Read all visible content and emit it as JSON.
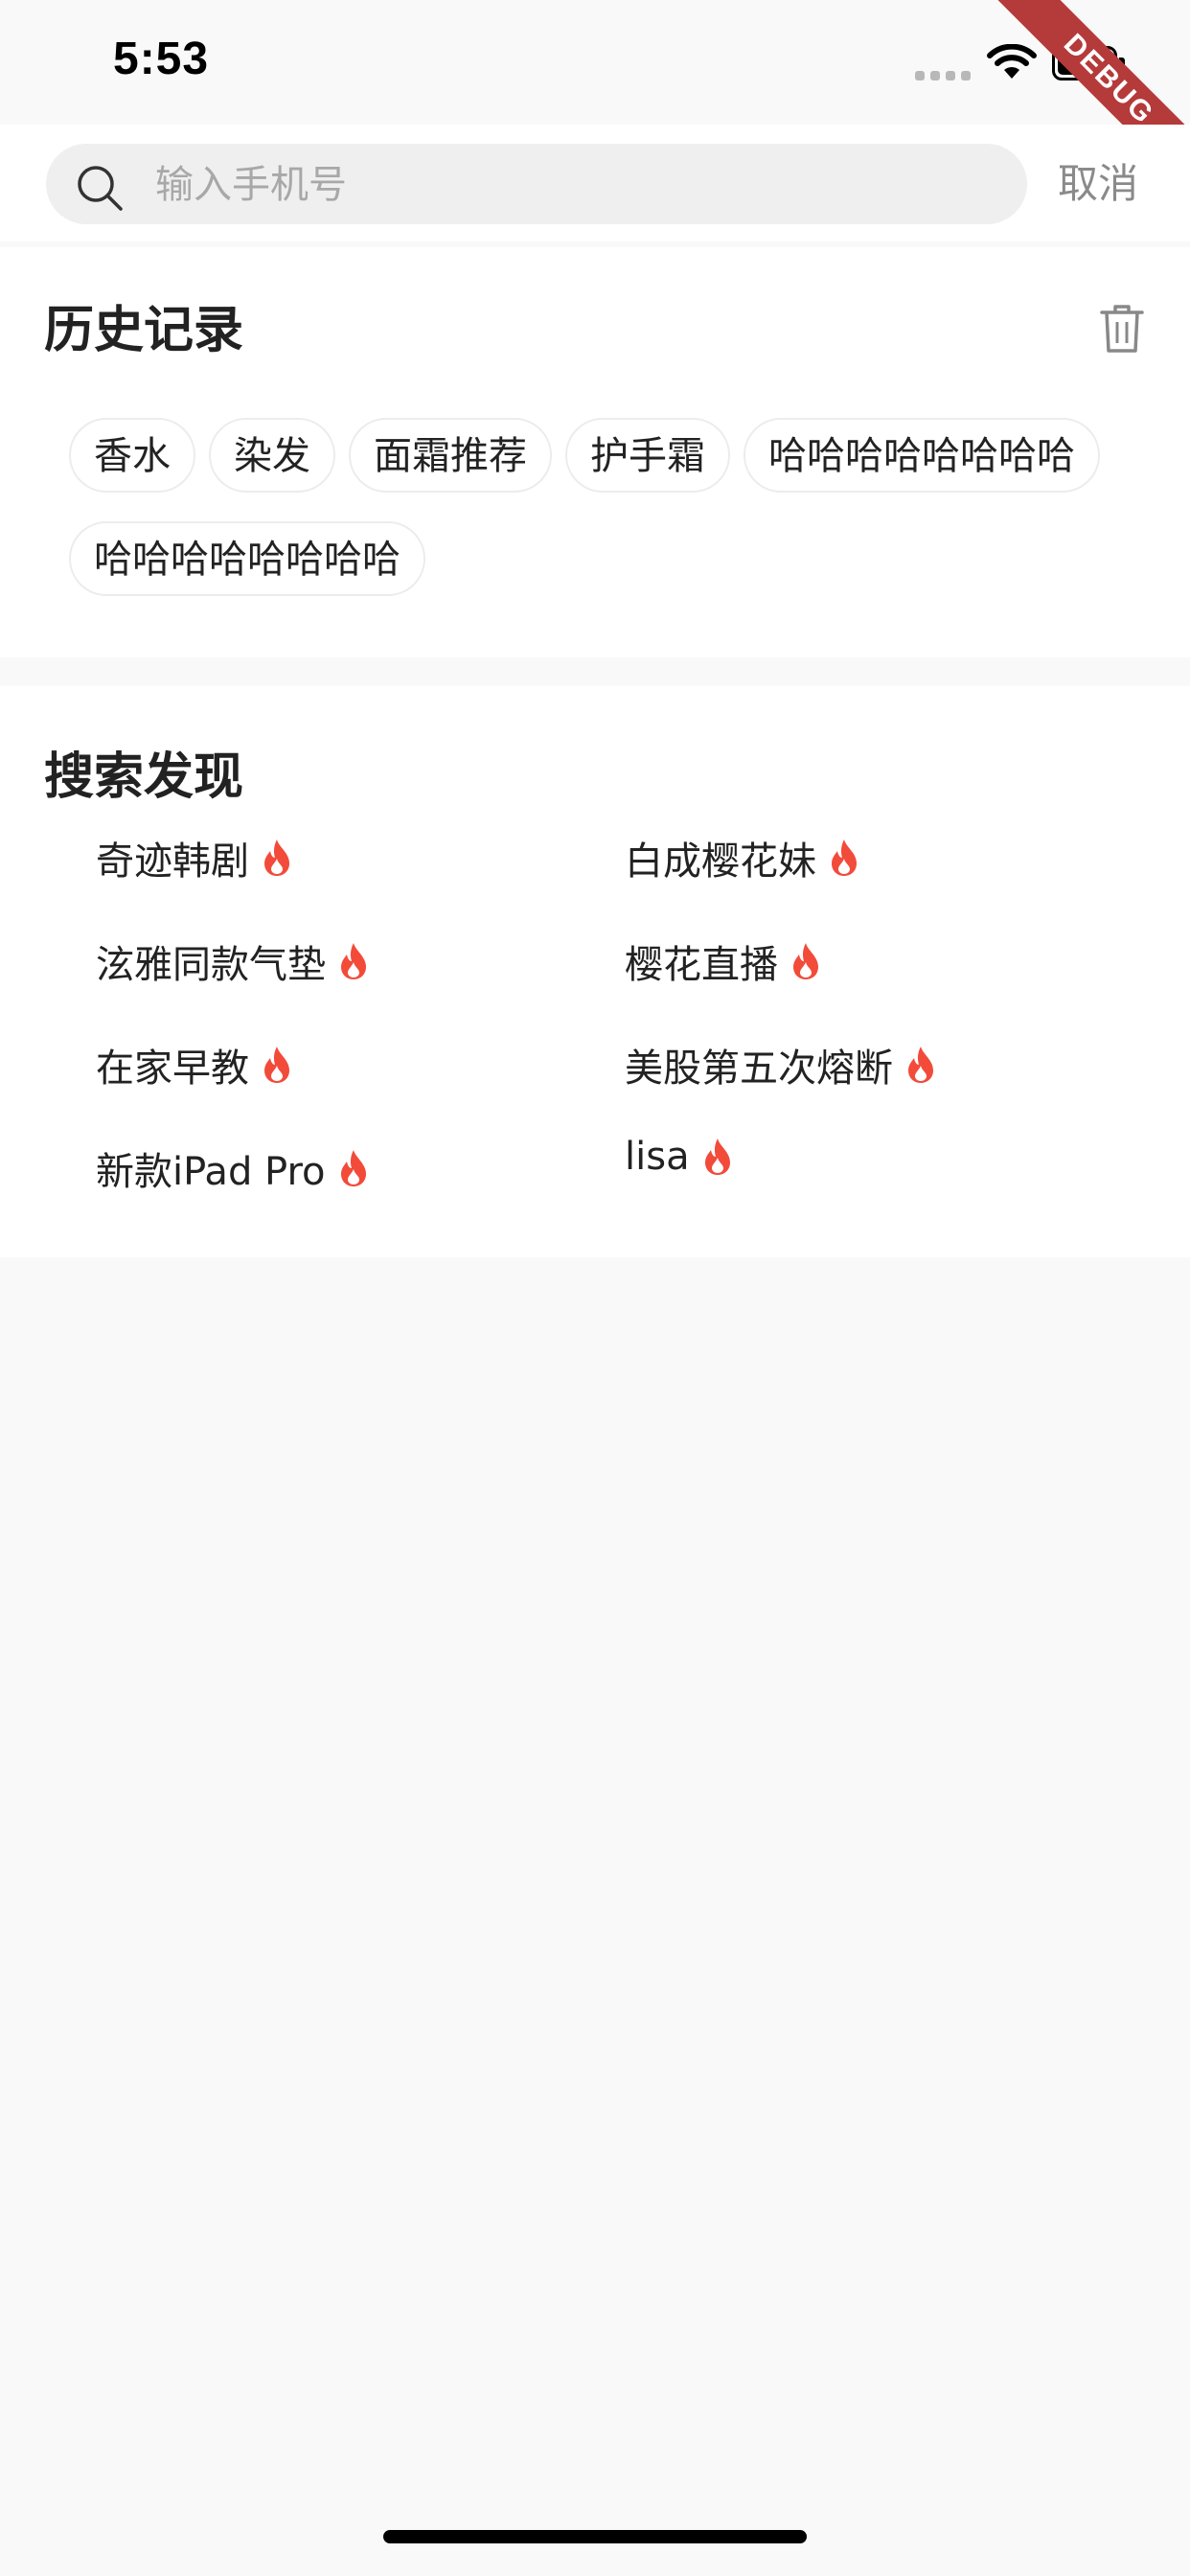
{
  "status_bar": {
    "time": "5:53"
  },
  "debug_banner": {
    "label": "DEBUG"
  },
  "search": {
    "placeholder": "输入手机号",
    "value": "",
    "cancel_label": "取消"
  },
  "history": {
    "title": "历史记录",
    "tags": [
      "香水",
      "染发",
      "面霜推荐",
      "护手霜",
      "哈哈哈哈哈哈哈哈",
      "哈哈哈哈哈哈哈哈"
    ]
  },
  "discover": {
    "title": "搜索发现",
    "items": [
      "奇迹韩剧",
      "白成樱花妹",
      "泫雅同款气垫",
      "樱花直播",
      "在家早教",
      "美股第五次熔断",
      "新款iPad Pro",
      "lisa"
    ]
  },
  "colors": {
    "fire": "#f24b3a",
    "debug": "#b53a3a",
    "background": "#f9f9f9"
  },
  "icons": [
    "search-icon",
    "trash-icon",
    "fire-icon",
    "wifi-icon",
    "battery-icon"
  ]
}
